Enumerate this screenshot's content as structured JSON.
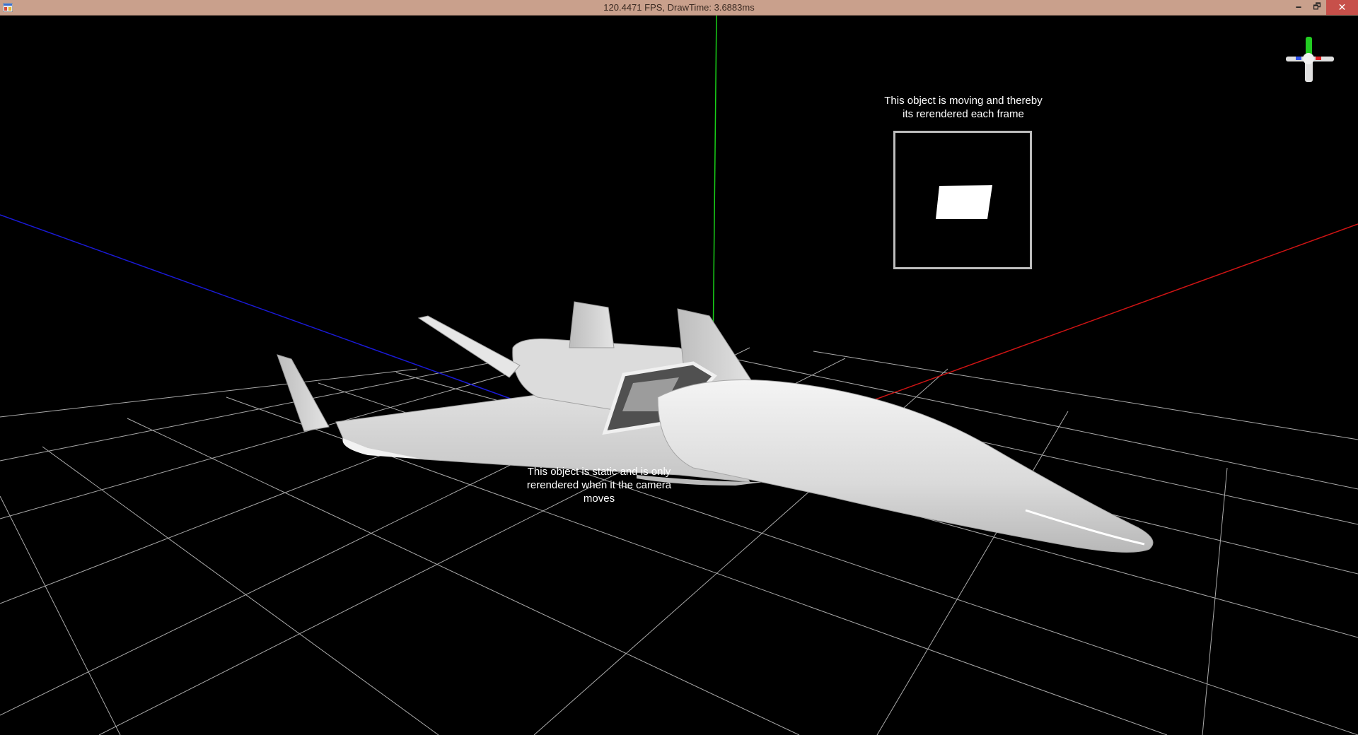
{
  "window": {
    "title": "120.4471 FPS, DrawTime: 3.6883ms",
    "minimize_glyph": "🗕",
    "maximize_glyph": "🗗",
    "close_glyph": "✕",
    "icon": "app-icon"
  },
  "scene": {
    "moving_label": "This object is moving and thereby\nits rerendered each frame",
    "static_label": "This object is static and is only\nrerendered when it the camera\nmoves",
    "axis_colors": {
      "x": "#d01414",
      "y": "#18d018",
      "z": "#1a1ad8"
    },
    "grid_color": "#bdbdbd",
    "model_color": "#e8e8e8",
    "background": "#000000"
  },
  "gizmo": {
    "icon": "orientation-gizmo-icon"
  }
}
